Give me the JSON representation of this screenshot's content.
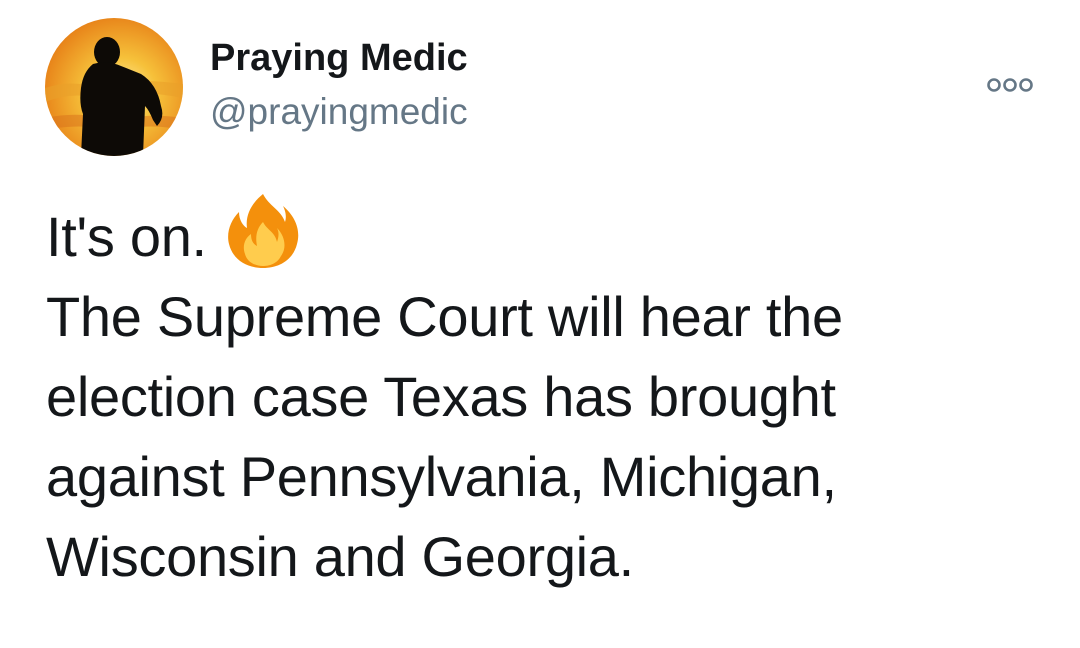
{
  "user": {
    "display_name": "Praying Medic",
    "handle": "@prayingmedic",
    "avatar_icon": "silhouette-sunset-avatar"
  },
  "menu": {
    "icon": "more-options-icon"
  },
  "tweet": {
    "first_line": "It's on.",
    "emoji_icon": "fire-icon",
    "lines": [
      "The Supreme Court will hear the",
      "election case Texas has brought",
      "against Pennsylvania, Michigan,",
      "Wisconsin and Georgia."
    ]
  },
  "colors": {
    "text": "#14171a",
    "secondary_text": "#657786",
    "avatar_sky_top": "#f2b134",
    "avatar_sky_bottom": "#d65a0c",
    "fire_outer": "#f4900c",
    "fire_inner": "#ffcc4d"
  }
}
